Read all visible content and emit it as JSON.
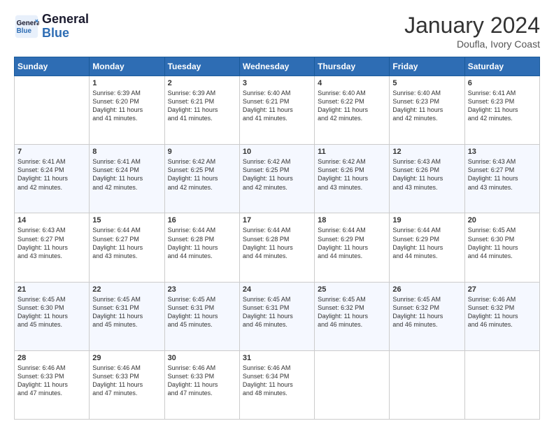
{
  "header": {
    "logo_line1": "General",
    "logo_line2": "Blue",
    "month": "January 2024",
    "location": "Doufla, Ivory Coast"
  },
  "weekdays": [
    "Sunday",
    "Monday",
    "Tuesday",
    "Wednesday",
    "Thursday",
    "Friday",
    "Saturday"
  ],
  "weeks": [
    [
      {
        "day": "",
        "info": ""
      },
      {
        "day": "1",
        "info": "Sunrise: 6:39 AM\nSunset: 6:20 PM\nDaylight: 11 hours\nand 41 minutes."
      },
      {
        "day": "2",
        "info": "Sunrise: 6:39 AM\nSunset: 6:21 PM\nDaylight: 11 hours\nand 41 minutes."
      },
      {
        "day": "3",
        "info": "Sunrise: 6:40 AM\nSunset: 6:21 PM\nDaylight: 11 hours\nand 41 minutes."
      },
      {
        "day": "4",
        "info": "Sunrise: 6:40 AM\nSunset: 6:22 PM\nDaylight: 11 hours\nand 42 minutes."
      },
      {
        "day": "5",
        "info": "Sunrise: 6:40 AM\nSunset: 6:23 PM\nDaylight: 11 hours\nand 42 minutes."
      },
      {
        "day": "6",
        "info": "Sunrise: 6:41 AM\nSunset: 6:23 PM\nDaylight: 11 hours\nand 42 minutes."
      }
    ],
    [
      {
        "day": "7",
        "info": "Sunrise: 6:41 AM\nSunset: 6:24 PM\nDaylight: 11 hours\nand 42 minutes."
      },
      {
        "day": "8",
        "info": "Sunrise: 6:41 AM\nSunset: 6:24 PM\nDaylight: 11 hours\nand 42 minutes."
      },
      {
        "day": "9",
        "info": "Sunrise: 6:42 AM\nSunset: 6:25 PM\nDaylight: 11 hours\nand 42 minutes."
      },
      {
        "day": "10",
        "info": "Sunrise: 6:42 AM\nSunset: 6:25 PM\nDaylight: 11 hours\nand 42 minutes."
      },
      {
        "day": "11",
        "info": "Sunrise: 6:42 AM\nSunset: 6:26 PM\nDaylight: 11 hours\nand 43 minutes."
      },
      {
        "day": "12",
        "info": "Sunrise: 6:43 AM\nSunset: 6:26 PM\nDaylight: 11 hours\nand 43 minutes."
      },
      {
        "day": "13",
        "info": "Sunrise: 6:43 AM\nSunset: 6:27 PM\nDaylight: 11 hours\nand 43 minutes."
      }
    ],
    [
      {
        "day": "14",
        "info": "Sunrise: 6:43 AM\nSunset: 6:27 PM\nDaylight: 11 hours\nand 43 minutes."
      },
      {
        "day": "15",
        "info": "Sunrise: 6:44 AM\nSunset: 6:27 PM\nDaylight: 11 hours\nand 43 minutes."
      },
      {
        "day": "16",
        "info": "Sunrise: 6:44 AM\nSunset: 6:28 PM\nDaylight: 11 hours\nand 44 minutes."
      },
      {
        "day": "17",
        "info": "Sunrise: 6:44 AM\nSunset: 6:28 PM\nDaylight: 11 hours\nand 44 minutes."
      },
      {
        "day": "18",
        "info": "Sunrise: 6:44 AM\nSunset: 6:29 PM\nDaylight: 11 hours\nand 44 minutes."
      },
      {
        "day": "19",
        "info": "Sunrise: 6:44 AM\nSunset: 6:29 PM\nDaylight: 11 hours\nand 44 minutes."
      },
      {
        "day": "20",
        "info": "Sunrise: 6:45 AM\nSunset: 6:30 PM\nDaylight: 11 hours\nand 44 minutes."
      }
    ],
    [
      {
        "day": "21",
        "info": "Sunrise: 6:45 AM\nSunset: 6:30 PM\nDaylight: 11 hours\nand 45 minutes."
      },
      {
        "day": "22",
        "info": "Sunrise: 6:45 AM\nSunset: 6:31 PM\nDaylight: 11 hours\nand 45 minutes."
      },
      {
        "day": "23",
        "info": "Sunrise: 6:45 AM\nSunset: 6:31 PM\nDaylight: 11 hours\nand 45 minutes."
      },
      {
        "day": "24",
        "info": "Sunrise: 6:45 AM\nSunset: 6:31 PM\nDaylight: 11 hours\nand 46 minutes."
      },
      {
        "day": "25",
        "info": "Sunrise: 6:45 AM\nSunset: 6:32 PM\nDaylight: 11 hours\nand 46 minutes."
      },
      {
        "day": "26",
        "info": "Sunrise: 6:45 AM\nSunset: 6:32 PM\nDaylight: 11 hours\nand 46 minutes."
      },
      {
        "day": "27",
        "info": "Sunrise: 6:46 AM\nSunset: 6:32 PM\nDaylight: 11 hours\nand 46 minutes."
      }
    ],
    [
      {
        "day": "28",
        "info": "Sunrise: 6:46 AM\nSunset: 6:33 PM\nDaylight: 11 hours\nand 47 minutes."
      },
      {
        "day": "29",
        "info": "Sunrise: 6:46 AM\nSunset: 6:33 PM\nDaylight: 11 hours\nand 47 minutes."
      },
      {
        "day": "30",
        "info": "Sunrise: 6:46 AM\nSunset: 6:33 PM\nDaylight: 11 hours\nand 47 minutes."
      },
      {
        "day": "31",
        "info": "Sunrise: 6:46 AM\nSunset: 6:34 PM\nDaylight: 11 hours\nand 48 minutes."
      },
      {
        "day": "",
        "info": ""
      },
      {
        "day": "",
        "info": ""
      },
      {
        "day": "",
        "info": ""
      }
    ]
  ]
}
